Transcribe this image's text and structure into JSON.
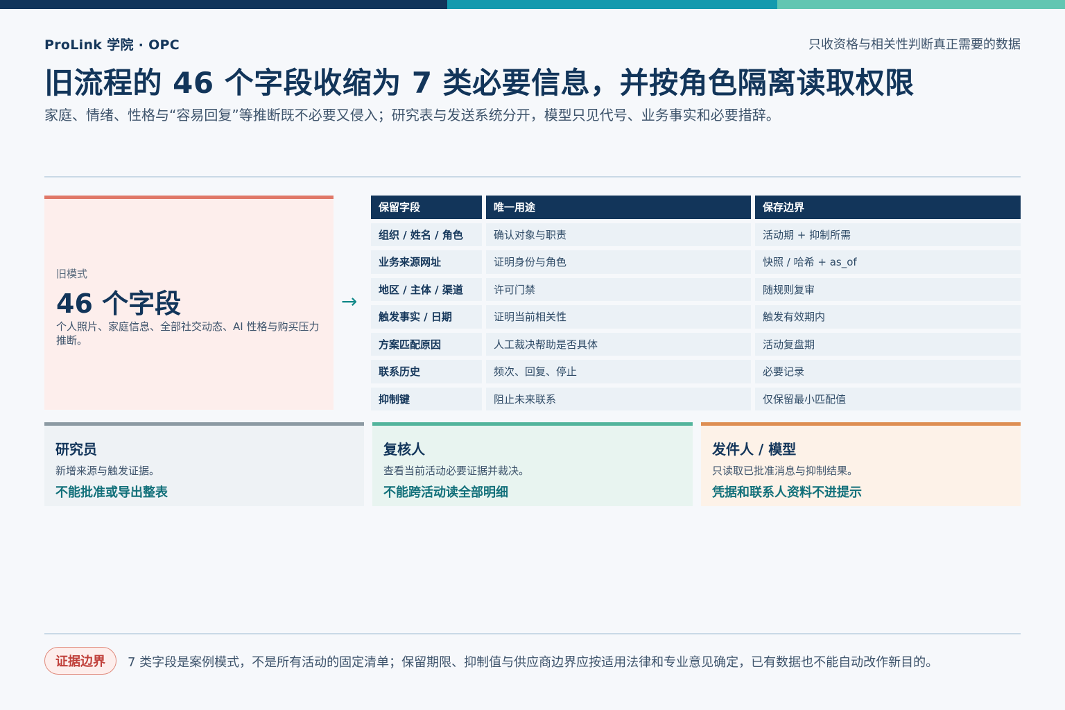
{
  "header": {
    "brand": "ProLink 学院 · OPC",
    "tagline": "只收资格与相关性判断真正需要的数据",
    "title": "旧流程的 46 个字段收缩为 7 类必要信息，并按角色隔离读取权限",
    "subtitle": "家庭、情绪、性格与“容易回复”等推断既不必要又侵入；研究表与发送系统分开，模型只见代号、业务事实和必要措辞。"
  },
  "old_mode": {
    "label": "旧模式",
    "count": "46 个字段",
    "description": "个人照片、家庭信息、全部社交动态、AI 性格与购买压力推断。"
  },
  "arrow": "→",
  "table": {
    "headers": [
      "保留字段",
      "唯一用途",
      "保存边界"
    ],
    "rows": [
      [
        "组织 / 姓名 / 角色",
        "确认对象与职责",
        "活动期 + 抑制所需"
      ],
      [
        "业务来源网址",
        "证明身份与角色",
        "快照 / 哈希 + as_of"
      ],
      [
        "地区 / 主体 / 渠道",
        "许可门禁",
        "随规则复审"
      ],
      [
        "触发事实 / 日期",
        "证明当前相关性",
        "触发有效期内"
      ],
      [
        "方案匹配原因",
        "人工裁决帮助是否具体",
        "活动复盘期"
      ],
      [
        "联系历史",
        "频次、回复、停止",
        "必要记录"
      ],
      [
        "抑制键",
        "阻止未来联系",
        "仅保留最小匹配值"
      ]
    ]
  },
  "roles": [
    {
      "title": "研究员",
      "desc": "新增来源与触发证据。",
      "limit": "不能批准或导出整表"
    },
    {
      "title": "复核人",
      "desc": "查看当前活动必要证据并裁决。",
      "limit": "不能跨活动读全部明细"
    },
    {
      "title": "发件人 / 模型",
      "desc": "只读取已批准消息与抑制结果。",
      "limit": "凭据和联系人资料不进提示"
    }
  ],
  "footer": {
    "badge": "证据边界",
    "note": "7 类字段是案例模式，不是所有活动的固定清单；保留期限、抑制值与供应商边界应按适用法律和专业意见确定，已有数据也不能自动改作新目的。"
  }
}
